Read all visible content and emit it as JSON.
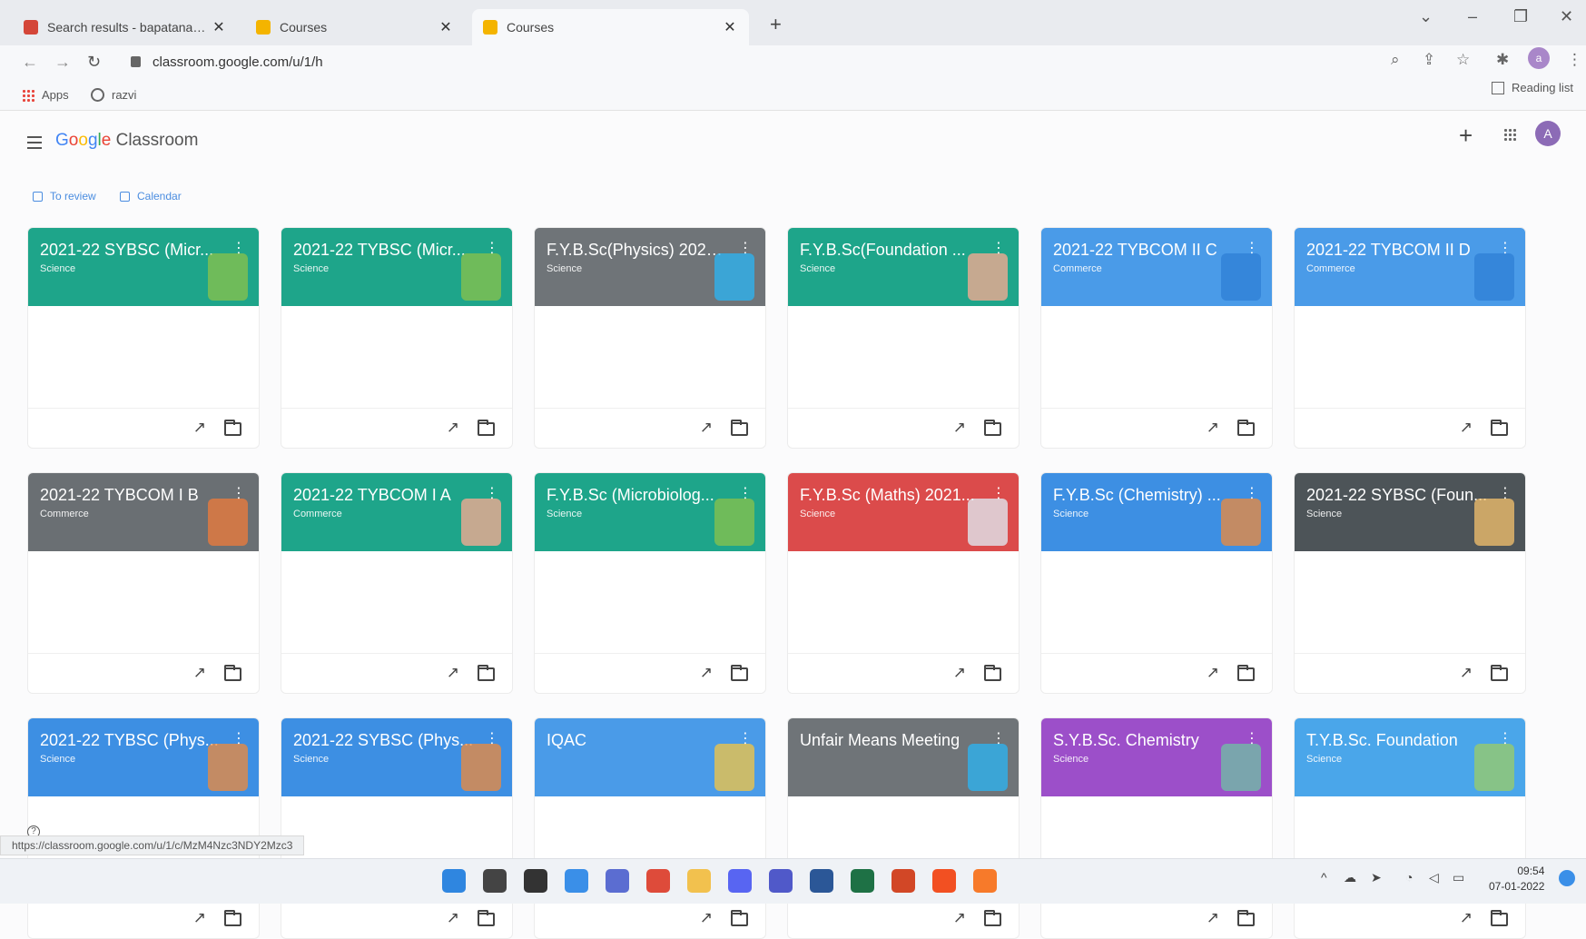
{
  "browser": {
    "tabs": [
      {
        "title": "Search results - bapatanaghad",
        "favicon_color": "#d44638",
        "active": false
      },
      {
        "title": "Courses",
        "favicon_color": "#f4b400",
        "active": false
      },
      {
        "title": "Courses",
        "favicon_color": "#f4b400",
        "active": true
      }
    ],
    "new_tab": "+",
    "url": "classroom.google.com/u/1/h",
    "bookmarks": [
      "Apps",
      "razvi"
    ],
    "reading_list": "Reading list",
    "profile_initial": "a"
  },
  "classroom": {
    "brand_google": [
      "G",
      "o",
      "o",
      "g",
      "l",
      "e"
    ],
    "brand_product": "Classroom",
    "user_initial": "A",
    "add": "+",
    "links": {
      "to_review": "To review",
      "calendar": "Calendar"
    }
  },
  "courses": [
    {
      "title": "2021-22 SYBSC (Micr...",
      "subject": "Science",
      "color": "#1ea58a",
      "deco": "#8bc34a"
    },
    {
      "title": "2021-22 TYBSC (Micr...",
      "subject": "Science",
      "color": "#1ea58a",
      "deco": "#8bc34a"
    },
    {
      "title": "F.Y.B.Sc(Physics) 2021...",
      "subject": "Science",
      "color": "#6f7478",
      "deco": "#29b6f6"
    },
    {
      "title": "F.Y.B.Sc(Foundation ...",
      "subject": "Science",
      "color": "#1ea58a",
      "deco": "#ffab91"
    },
    {
      "title": "2021-22 TYBCOM II C",
      "subject": "Commerce",
      "color": "#4a9be8",
      "deco": "#2f7fd6"
    },
    {
      "title": "2021-22 TYBCOM II D",
      "subject": "Commerce",
      "color": "#4a9be8",
      "deco": "#2f7fd6"
    },
    {
      "title": "2021-22 TYBCOM I B",
      "subject": "Commerce",
      "color": "#6a6f73",
      "deco": "#f07b3a"
    },
    {
      "title": "2021-22 TYBCOM I A",
      "subject": "Commerce",
      "color": "#1ea58a",
      "deco": "#ffab91"
    },
    {
      "title": "F.Y.B.Sc (Microbiolog...",
      "subject": "Science",
      "color": "#1ea58a",
      "deco": "#8bc34a"
    },
    {
      "title": "F.Y.B.Sc (Maths) 2021...",
      "subject": "Science",
      "color": "#db4b4b",
      "deco": "#e0f0f8"
    },
    {
      "title": "F.Y.B.Sc (Chemistry) ...",
      "subject": "Science",
      "color": "#3d8fe3",
      "deco": "#f08a3a"
    },
    {
      "title": "2021-22 SYBSC (Foun...",
      "subject": "Science",
      "color": "#4d5458",
      "deco": "#f5c16c"
    },
    {
      "title": "2021-22 TYBSC (Phys...",
      "subject": "Science",
      "color": "#3d8fe3",
      "deco": "#f08a3a"
    },
    {
      "title": "2021-22 SYBSC (Phys...",
      "subject": "Science",
      "color": "#3d8fe3",
      "deco": "#f08a3a"
    },
    {
      "title": "IQAC",
      "subject": "",
      "color": "#4a9be8",
      "deco": "#f5c542"
    },
    {
      "title": "Unfair Means Meeting",
      "subject": "",
      "color": "#6f7478",
      "deco": "#29b6f6"
    },
    {
      "title": "S.Y.B.Sc. Chemistry",
      "subject": "Science",
      "color": "#9c4fc9",
      "deco": "#6fc2a3"
    },
    {
      "title": "T.Y.B.Sc. Foundation",
      "subject": "Science",
      "color": "#4aa6ea",
      "deco": "#9ccc65"
    }
  ],
  "status_url": "https://classroom.google.com/u/1/c/MzM4Nzc3NDY2Mzc3",
  "taskbar": {
    "time": "09:54",
    "date": "07-01-2022",
    "apps": [
      {
        "name": "start",
        "color": "#2f86e0"
      },
      {
        "name": "search",
        "color": "#444444"
      },
      {
        "name": "task-view",
        "color": "#333333"
      },
      {
        "name": "widgets",
        "color": "#3a8fe8"
      },
      {
        "name": "teams-chat",
        "color": "#5b6dd1"
      },
      {
        "name": "chrome",
        "color": "#de4b3a"
      },
      {
        "name": "file-explorer",
        "color": "#f2c14e"
      },
      {
        "name": "discord",
        "color": "#5865f2"
      },
      {
        "name": "teams",
        "color": "#5059c9"
      },
      {
        "name": "word",
        "color": "#2b5797"
      },
      {
        "name": "excel",
        "color": "#1e7145"
      },
      {
        "name": "powerpoint",
        "color": "#d24726"
      },
      {
        "name": "store",
        "color": "#f25022"
      },
      {
        "name": "firefox",
        "color": "#f77a2a"
      }
    ]
  }
}
